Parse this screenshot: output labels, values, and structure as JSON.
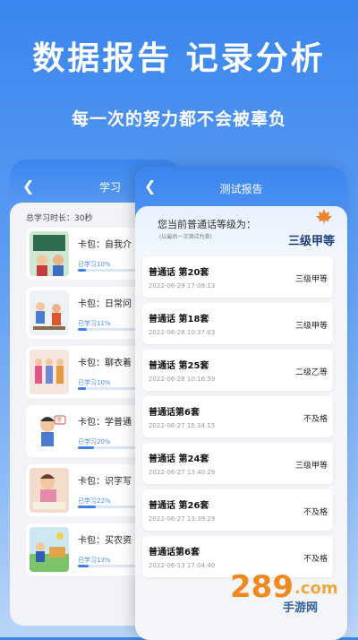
{
  "headline": "数据报告 记录分析",
  "subline": "每一次的努力都不会被辜负",
  "study": {
    "header_title": "学习",
    "study_time": "总学习时长：30秒",
    "items": [
      {
        "name": "卡包：自我介",
        "progress_label": "已学习10%",
        "progress": 0.1
      },
      {
        "name": "卡包：日常问",
        "progress_label": "已学习11%",
        "progress": 0.11
      },
      {
        "name": "卡包：聊衣着",
        "progress_label": "已学习10%",
        "progress": 0.1
      },
      {
        "name": "卡包：学普通",
        "progress_label": "已学习20%",
        "progress": 0.2
      },
      {
        "name": "卡包：识字写",
        "progress_label": "已学习22%",
        "progress": 0.22
      },
      {
        "name": "卡包：买农资",
        "progress_label": "已学习13%",
        "progress": 0.13
      }
    ]
  },
  "report": {
    "title": "测试报告",
    "level_question": "您当前普通话等级为：",
    "level_note": "(以最后一次测试为准)",
    "level": "三级甲等",
    "tests": [
      {
        "name": "普通话 第20套",
        "date": "2022-06-29 17:08:13",
        "grade": "三级甲等"
      },
      {
        "name": "普通话 第18套",
        "date": "2022-06-28 10:37:03",
        "grade": "三级甲等"
      },
      {
        "name": "普通话 第25套",
        "date": "2022-06-28 10:16:59",
        "grade": "二级乙等"
      },
      {
        "name": "普通话第6套",
        "date": "2022-06-27 15:34:15",
        "grade": "不及格"
      },
      {
        "name": "普通话 第24套",
        "date": "2022-06-27 13:40:29",
        "grade": "三级甲等"
      },
      {
        "name": "普通话 第26套",
        "date": "2022-06-27 13:39:29",
        "grade": "不及格"
      },
      {
        "name": "普通话第6套",
        "date": "2022-06-13 17:04:40",
        "grade": "不及格"
      }
    ]
  },
  "watermark": {
    "text": "手游网"
  }
}
